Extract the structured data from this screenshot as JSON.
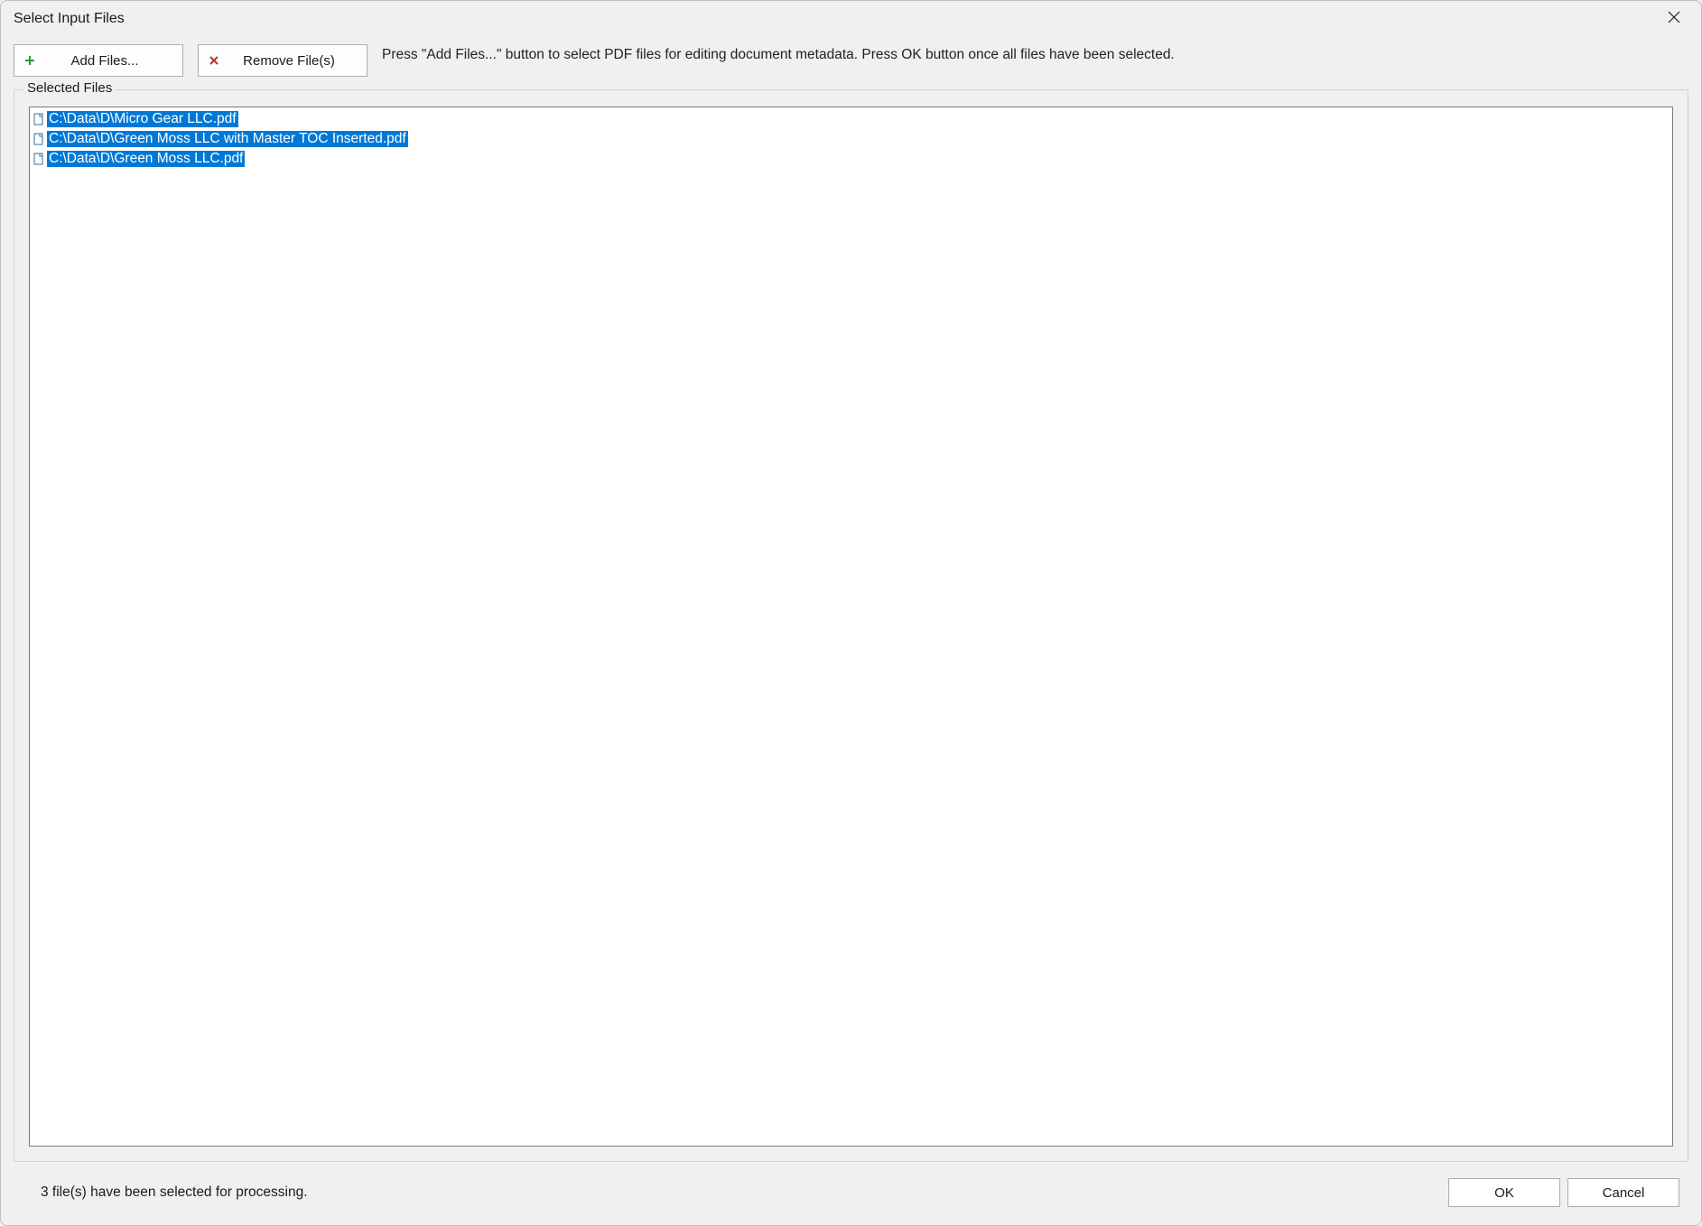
{
  "window": {
    "title": "Select Input Files"
  },
  "toolbar": {
    "add_label": "Add Files...",
    "remove_label": "Remove File(s)",
    "instructions": "Press \"Add Files...\" button to select PDF files for editing document metadata. Press OK button once all files have been selected."
  },
  "group": {
    "label": "Selected Files"
  },
  "files": [
    {
      "path": "C:\\Data\\D\\Micro Gear LLC.pdf",
      "selected": true
    },
    {
      "path": "C:\\Data\\D\\Green Moss LLC with Master TOC Inserted.pdf",
      "selected": true
    },
    {
      "path": "C:\\Data\\D\\Green Moss LLC.pdf",
      "selected": true
    }
  ],
  "footer": {
    "status": "3 file(s) have been selected for processing.",
    "ok_label": "OK",
    "cancel_label": "Cancel"
  }
}
